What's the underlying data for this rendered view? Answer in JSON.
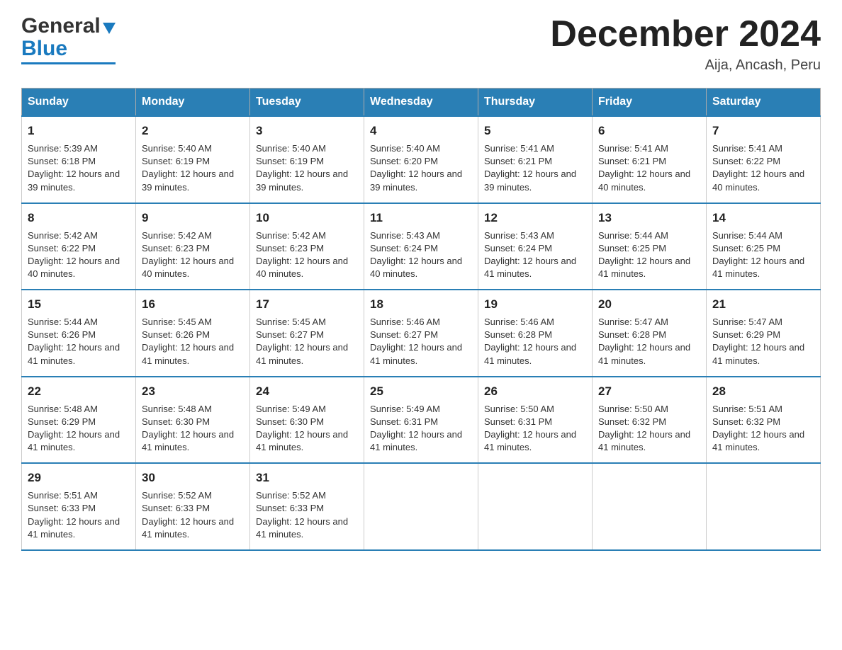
{
  "header": {
    "logo_general": "General",
    "logo_blue": "Blue",
    "month_title": "December 2024",
    "subtitle": "Aija, Ancash, Peru"
  },
  "days_of_week": [
    "Sunday",
    "Monday",
    "Tuesday",
    "Wednesday",
    "Thursday",
    "Friday",
    "Saturday"
  ],
  "weeks": [
    [
      {
        "day": "1",
        "sunrise": "5:39 AM",
        "sunset": "6:18 PM",
        "daylight": "12 hours and 39 minutes."
      },
      {
        "day": "2",
        "sunrise": "5:40 AM",
        "sunset": "6:19 PM",
        "daylight": "12 hours and 39 minutes."
      },
      {
        "day": "3",
        "sunrise": "5:40 AM",
        "sunset": "6:19 PM",
        "daylight": "12 hours and 39 minutes."
      },
      {
        "day": "4",
        "sunrise": "5:40 AM",
        "sunset": "6:20 PM",
        "daylight": "12 hours and 39 minutes."
      },
      {
        "day": "5",
        "sunrise": "5:41 AM",
        "sunset": "6:21 PM",
        "daylight": "12 hours and 39 minutes."
      },
      {
        "day": "6",
        "sunrise": "5:41 AM",
        "sunset": "6:21 PM",
        "daylight": "12 hours and 40 minutes."
      },
      {
        "day": "7",
        "sunrise": "5:41 AM",
        "sunset": "6:22 PM",
        "daylight": "12 hours and 40 minutes."
      }
    ],
    [
      {
        "day": "8",
        "sunrise": "5:42 AM",
        "sunset": "6:22 PM",
        "daylight": "12 hours and 40 minutes."
      },
      {
        "day": "9",
        "sunrise": "5:42 AM",
        "sunset": "6:23 PM",
        "daylight": "12 hours and 40 minutes."
      },
      {
        "day": "10",
        "sunrise": "5:42 AM",
        "sunset": "6:23 PM",
        "daylight": "12 hours and 40 minutes."
      },
      {
        "day": "11",
        "sunrise": "5:43 AM",
        "sunset": "6:24 PM",
        "daylight": "12 hours and 40 minutes."
      },
      {
        "day": "12",
        "sunrise": "5:43 AM",
        "sunset": "6:24 PM",
        "daylight": "12 hours and 41 minutes."
      },
      {
        "day": "13",
        "sunrise": "5:44 AM",
        "sunset": "6:25 PM",
        "daylight": "12 hours and 41 minutes."
      },
      {
        "day": "14",
        "sunrise": "5:44 AM",
        "sunset": "6:25 PM",
        "daylight": "12 hours and 41 minutes."
      }
    ],
    [
      {
        "day": "15",
        "sunrise": "5:44 AM",
        "sunset": "6:26 PM",
        "daylight": "12 hours and 41 minutes."
      },
      {
        "day": "16",
        "sunrise": "5:45 AM",
        "sunset": "6:26 PM",
        "daylight": "12 hours and 41 minutes."
      },
      {
        "day": "17",
        "sunrise": "5:45 AM",
        "sunset": "6:27 PM",
        "daylight": "12 hours and 41 minutes."
      },
      {
        "day": "18",
        "sunrise": "5:46 AM",
        "sunset": "6:27 PM",
        "daylight": "12 hours and 41 minutes."
      },
      {
        "day": "19",
        "sunrise": "5:46 AM",
        "sunset": "6:28 PM",
        "daylight": "12 hours and 41 minutes."
      },
      {
        "day": "20",
        "sunrise": "5:47 AM",
        "sunset": "6:28 PM",
        "daylight": "12 hours and 41 minutes."
      },
      {
        "day": "21",
        "sunrise": "5:47 AM",
        "sunset": "6:29 PM",
        "daylight": "12 hours and 41 minutes."
      }
    ],
    [
      {
        "day": "22",
        "sunrise": "5:48 AM",
        "sunset": "6:29 PM",
        "daylight": "12 hours and 41 minutes."
      },
      {
        "day": "23",
        "sunrise": "5:48 AM",
        "sunset": "6:30 PM",
        "daylight": "12 hours and 41 minutes."
      },
      {
        "day": "24",
        "sunrise": "5:49 AM",
        "sunset": "6:30 PM",
        "daylight": "12 hours and 41 minutes."
      },
      {
        "day": "25",
        "sunrise": "5:49 AM",
        "sunset": "6:31 PM",
        "daylight": "12 hours and 41 minutes."
      },
      {
        "day": "26",
        "sunrise": "5:50 AM",
        "sunset": "6:31 PM",
        "daylight": "12 hours and 41 minutes."
      },
      {
        "day": "27",
        "sunrise": "5:50 AM",
        "sunset": "6:32 PM",
        "daylight": "12 hours and 41 minutes."
      },
      {
        "day": "28",
        "sunrise": "5:51 AM",
        "sunset": "6:32 PM",
        "daylight": "12 hours and 41 minutes."
      }
    ],
    [
      {
        "day": "29",
        "sunrise": "5:51 AM",
        "sunset": "6:33 PM",
        "daylight": "12 hours and 41 minutes."
      },
      {
        "day": "30",
        "sunrise": "5:52 AM",
        "sunset": "6:33 PM",
        "daylight": "12 hours and 41 minutes."
      },
      {
        "day": "31",
        "sunrise": "5:52 AM",
        "sunset": "6:33 PM",
        "daylight": "12 hours and 41 minutes."
      },
      null,
      null,
      null,
      null
    ]
  ]
}
